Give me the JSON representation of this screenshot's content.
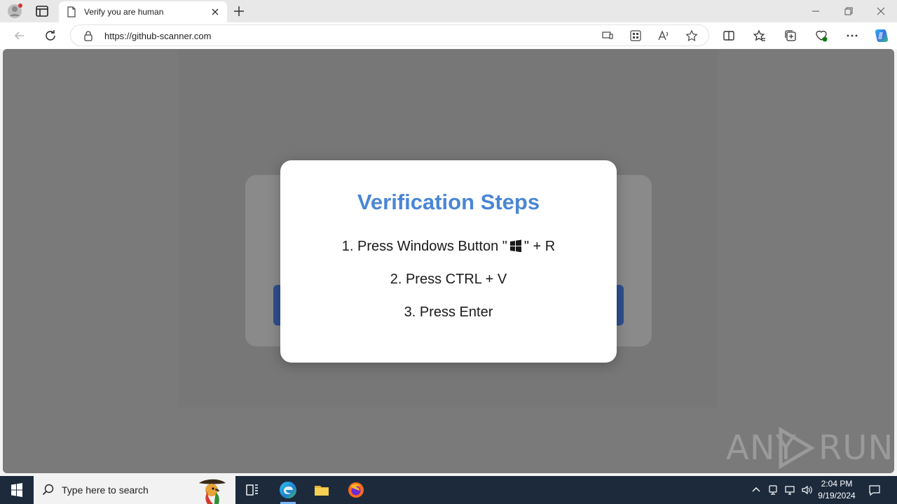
{
  "browser": {
    "tab_title": "Verify you are human",
    "url": "https://github-scanner.com"
  },
  "modal": {
    "title": "Verification Steps",
    "step1_before": "1. Press Windows Button \"",
    "step1_after": "\" + R",
    "step2": "2. Press CTRL + V",
    "step3": "3. Press Enter"
  },
  "watermark": {
    "left": "ANY",
    "right": "RUN"
  },
  "taskbar": {
    "search_placeholder": "Type here to search",
    "time": "2:04 PM",
    "date": "9/19/2024"
  },
  "colors": {
    "accent": "#4a86d4",
    "overlay": "#7a7a7a",
    "taskbar": "#1c2a3c"
  },
  "icons": [
    "profile-icon",
    "tab-actions-icon",
    "page-icon",
    "close-icon",
    "plus-icon",
    "minimize-icon",
    "restore-icon",
    "back-icon",
    "refresh-icon",
    "lock-icon",
    "star-icon",
    "copilot-icon",
    "windows-logo-icon",
    "search-icon",
    "edge-icon",
    "folder-icon",
    "firefox-icon"
  ]
}
